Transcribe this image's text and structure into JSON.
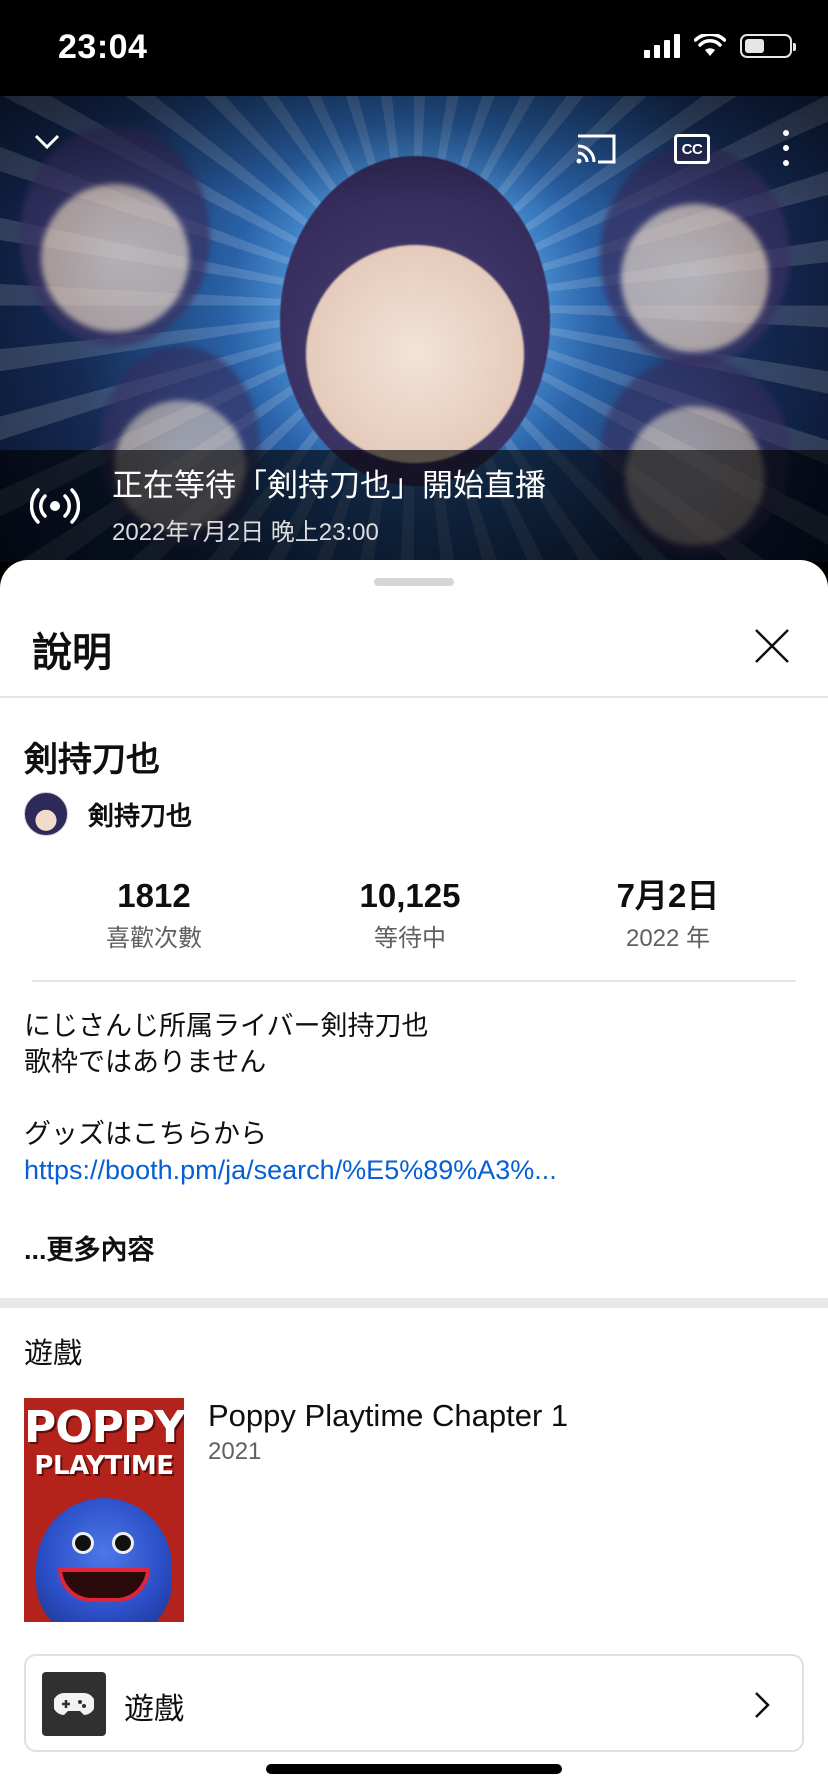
{
  "status_bar": {
    "time": "23:04",
    "battery_level": 0.45
  },
  "video": {
    "waiting_title": "正在等待「剣持刀也」開始直播",
    "scheduled_time": "2022年7月2日 晚上23:00",
    "controls": [
      "chevron-down-icon",
      "cast-icon",
      "cc-icon",
      "more-vert-icon"
    ],
    "cc_label": "CC"
  },
  "sheet": {
    "title": "說明",
    "video_title": "剣持刀也",
    "channel_name": "剣持刀也",
    "stats": [
      {
        "value": "1812",
        "label": "喜歡次數"
      },
      {
        "value": "10,125",
        "label": "等待中"
      },
      {
        "value": "7月2日",
        "label": "2022 年"
      }
    ],
    "description_lines": [
      "にじさんじ所属ライバー剣持刀也",
      "歌枠ではありません",
      "",
      "グッズはこちらから"
    ],
    "description_link": "https://booth.pm/ja/search/%E5%89%A3%...",
    "more_label": "...更多內容",
    "games_section_label": "遊戲",
    "game": {
      "cover_line1": "POPPY",
      "cover_line2": "PLAYTIME",
      "name": "Poppy Playtime Chapter 1",
      "year": "2021"
    },
    "games_button_label": "遊戲"
  },
  "colors": {
    "link": "#065fd4",
    "text": "#0f0f0f",
    "secondary": "#606060"
  }
}
